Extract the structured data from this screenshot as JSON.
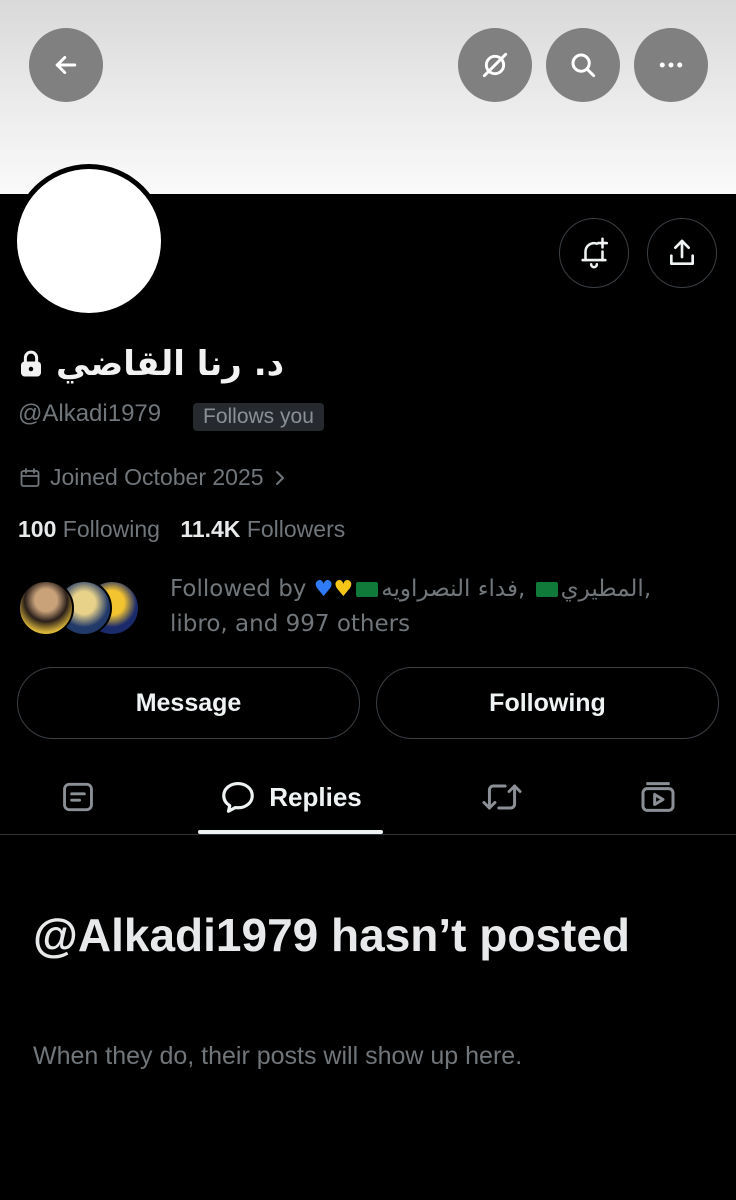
{
  "header": {
    "back_icon": "arrow-left-icon",
    "grok_icon": "grok-icon",
    "search_icon": "search-icon",
    "more_icon": "more-horizontal-icon"
  },
  "profile": {
    "display_name": "د. رنا القاضي",
    "protected_icon": "lock-icon",
    "handle": "@Alkadi1979",
    "follows_you": "Follows you",
    "joined": "Joined October 2025",
    "following_count": "100",
    "following_label": "Following",
    "followers_count": "11.4K",
    "followers_label": "Followers"
  },
  "followed_by": {
    "prefix": "Followed by",
    "name1": "فداء النصراويه",
    "name2": "المطيري",
    "line2": "libro, and 997 others",
    "colors": {
      "heart_blue": "#2f7bf5",
      "heart_yellow": "#f5c518",
      "flag_green": "#0f7a3a"
    }
  },
  "actions": {
    "message": "Message",
    "following": "Following"
  },
  "tabs": [
    {
      "icon": "posts-icon",
      "label": ""
    },
    {
      "icon": "reply-bubble-icon",
      "label": "Replies"
    },
    {
      "icon": "repost-icon",
      "label": ""
    },
    {
      "icon": "media-icon",
      "label": ""
    }
  ],
  "empty_state": {
    "title": "@Alkadi1979 hasn’t posted",
    "subtitle": "When they do, their posts will show up here."
  }
}
